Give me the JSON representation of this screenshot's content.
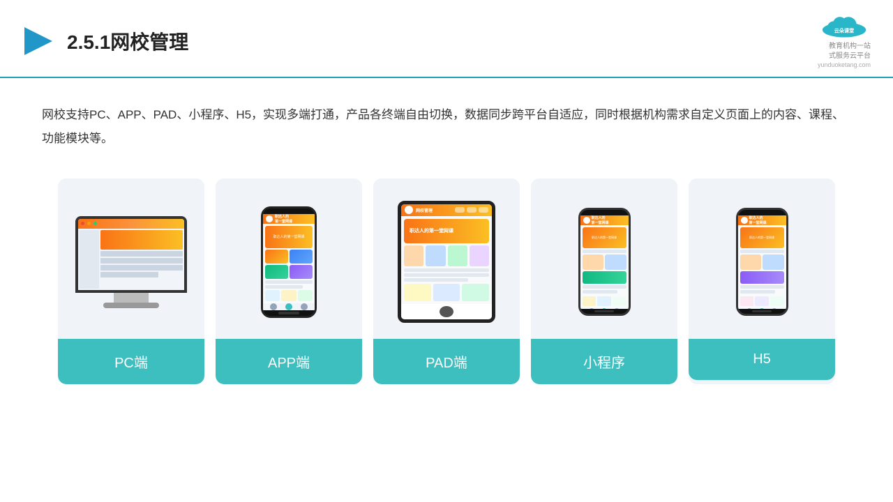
{
  "header": {
    "title": "2.5.1网校管理",
    "logo_name": "云朵课堂",
    "logo_sub": "yunduoketang.com",
    "logo_tagline": "教育机构一站\n式服务云平台"
  },
  "description": {
    "text": "网校支持PC、APP、PAD、小程序、H5，实现多端打通，产品各终端自由切换，数据同步跨平台自适应，同时根据机构需求自定义页面上的内容、课程、功能模块等。"
  },
  "cards": [
    {
      "id": "pc",
      "label": "PC端"
    },
    {
      "id": "app",
      "label": "APP端"
    },
    {
      "id": "pad",
      "label": "PAD端"
    },
    {
      "id": "miniprogram",
      "label": "小程序"
    },
    {
      "id": "h5",
      "label": "H5"
    }
  ],
  "colors": {
    "teal": "#3dbfbf",
    "header_line": "#1a9fb5",
    "title": "#222222",
    "body_text": "#333333"
  }
}
